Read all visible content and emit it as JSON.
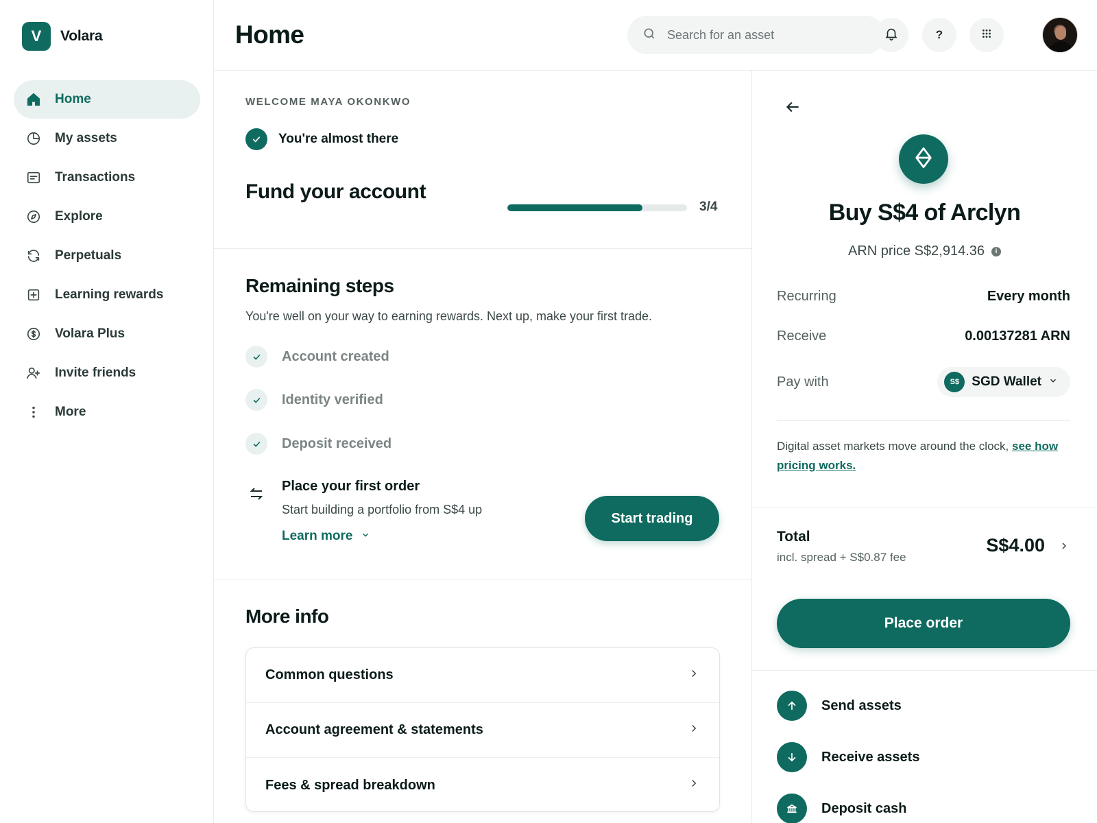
{
  "brand": {
    "logo_letter": "V",
    "name": "Volara"
  },
  "sidebar": {
    "items": [
      {
        "label": "Home",
        "icon": "home-icon",
        "active": true
      },
      {
        "label": "My assets",
        "icon": "pie-chart-icon"
      },
      {
        "label": "Transactions",
        "icon": "receipt-icon"
      },
      {
        "label": "Explore",
        "icon": "compass-icon"
      },
      {
        "label": "Perpetuals",
        "icon": "refresh-icon"
      },
      {
        "label": "Learning rewards",
        "icon": "plus-square-icon"
      },
      {
        "label": "Volara Plus",
        "icon": "coin-icon"
      },
      {
        "label": "Invite friends",
        "icon": "user-plus-icon"
      },
      {
        "label": "More",
        "icon": "more-vertical-icon"
      }
    ]
  },
  "header": {
    "title": "Home",
    "search_placeholder": "Search for an asset",
    "help_label": "?"
  },
  "onboarding": {
    "welcome": "WELCOME MAYA OKONKWO",
    "status": "You're almost there",
    "title": "Fund your account",
    "progress_label": "3/4",
    "progress_fraction": 0.75
  },
  "remaining": {
    "title": "Remaining steps",
    "description": "You're well on your way to earning rewards. Next up, make your first trade.",
    "steps": [
      {
        "label": "Account created",
        "done": true
      },
      {
        "label": "Identity verified",
        "done": true
      },
      {
        "label": "Deposit received",
        "done": true
      }
    ],
    "next_step": {
      "title": "Place your first order",
      "subtitle": "Start building a portfolio from S$4 up",
      "learn_more": "Learn more",
      "button": "Start trading"
    }
  },
  "more_info": {
    "title": "More info",
    "rows": [
      "Common questions",
      "Account agreement & statements",
      "Fees & spread breakdown"
    ]
  },
  "order_panel": {
    "title": "Buy S$4 of Arclyn",
    "price": "ARN price S$2,914.36",
    "recurring_label": "Recurring",
    "recurring_value": "Every month",
    "receive_label": "Receive",
    "receive_value": "0.00137281 ARN",
    "pay_with_label": "Pay with",
    "wallet_badge": "S$",
    "wallet_name": "SGD Wallet",
    "note_text": "Digital asset markets move around the clock, ",
    "note_link": "see how pricing works.",
    "total_label": "Total",
    "total_sub": "incl. spread + S$0.87 fee",
    "total_value": "S$4.00",
    "place_button": "Place order",
    "actions": [
      {
        "label": "Send assets",
        "icon": "arrow-up-icon"
      },
      {
        "label": "Receive assets",
        "icon": "arrow-down-icon"
      },
      {
        "label": "Deposit cash",
        "icon": "bank-icon"
      }
    ]
  },
  "colors": {
    "accent": "#0f6b5f",
    "accent_soft": "#e8f1f0",
    "border": "#e9ecec"
  }
}
